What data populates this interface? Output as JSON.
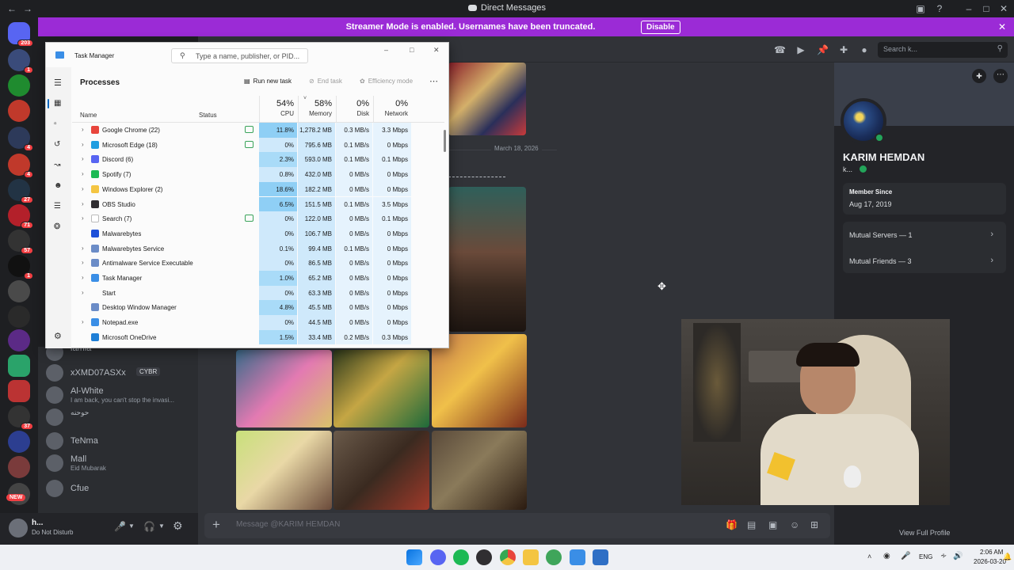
{
  "window": {
    "title": "Direct Messages"
  },
  "streamer_banner": {
    "message": "Streamer Mode is enabled. Usernames have been truncated.",
    "disable_label": "Disable"
  },
  "rail": {
    "home_badge": "203",
    "badges": [
      "1",
      "4",
      "4",
      "27",
      "71",
      "57",
      "1",
      "37"
    ],
    "new_label": "NEW"
  },
  "dm_list": [
    {
      "name": "lamia",
      "sub": ""
    },
    {
      "name": "xXMD07ASXx",
      "sub": "",
      "tag": "CYBR"
    },
    {
      "name": "Al-White",
      "sub": "I am back, you can't stop the invasi..."
    },
    {
      "name": "حوحنه",
      "sub": ""
    },
    {
      "name": "TeNma",
      "sub": ""
    },
    {
      "name": "Ma‌ll",
      "sub": "Eid Mubarak"
    },
    {
      "name": "Cfue",
      "sub": ""
    }
  ],
  "user_panel": {
    "name": "h...",
    "status": "Do Not Disturb"
  },
  "chat": {
    "date_divider": "March 18, 2026",
    "composer_placeholder": "Message @KARIM HEMDAN"
  },
  "header": {
    "search_placeholder": "Search k..."
  },
  "profile": {
    "display_name": "KARIM HEMDAN",
    "username": "k...",
    "member_since_label": "Member Since",
    "member_since_value": "Aug 17, 2019",
    "mutual_servers": "Mutual Servers — 1",
    "mutual_friends": "Mutual Friends — 3",
    "view_full_profile": "View Full Profile"
  },
  "task_manager": {
    "title": "Task Manager",
    "search_placeholder": "Type a name, publisher, or PID...",
    "section": "Processes",
    "run_new_task": "Run new task",
    "end_task": "End task",
    "efficiency_mode": "Efficiency mode",
    "col_name": "Name",
    "col_status": "Status",
    "cpu_total": "54%",
    "cpu_label": "CPU",
    "mem_total": "58%",
    "mem_label": "Memory",
    "disk_total": "0%",
    "disk_label": "Disk",
    "net_total": "0%",
    "net_label": "Network",
    "processes": [
      {
        "name": "Google Chrome (22)",
        "expand": true,
        "eco": true,
        "cpu": "11.8%",
        "mem": "1,278.2 MB",
        "disk": "0.3 MB/s",
        "net": "3.3 Mbps",
        "icon_color": "#e8453c"
      },
      {
        "name": "Microsoft Edge (18)",
        "expand": true,
        "eco": true,
        "cpu": "0%",
        "mem": "795.6 MB",
        "disk": "0.1 MB/s",
        "net": "0 Mbps",
        "icon_color": "#1f9de0"
      },
      {
        "name": "Discord (6)",
        "expand": true,
        "eco": false,
        "cpu": "2.3%",
        "mem": "593.0 MB",
        "disk": "0.1 MB/s",
        "net": "0.1 Mbps",
        "icon_color": "#5865f2"
      },
      {
        "name": "Spotify (7)",
        "expand": true,
        "eco": false,
        "cpu": "0.8%",
        "mem": "432.0 MB",
        "disk": "0 MB/s",
        "net": "0 Mbps",
        "icon_color": "#1db954"
      },
      {
        "name": "Windows Explorer (2)",
        "expand": true,
        "eco": false,
        "cpu": "18.6%",
        "mem": "182.2 MB",
        "disk": "0 MB/s",
        "net": "0 Mbps",
        "icon_color": "#f4c542"
      },
      {
        "name": "OBS Studio",
        "expand": true,
        "eco": false,
        "cpu": "6.5%",
        "mem": "151.5 MB",
        "disk": "0.1 MB/s",
        "net": "3.5 Mbps",
        "icon_color": "#302e31"
      },
      {
        "name": "Search (7)",
        "expand": true,
        "eco": true,
        "cpu": "0%",
        "mem": "122.0 MB",
        "disk": "0 MB/s",
        "net": "0.1 Mbps",
        "icon_color": "#ffffff"
      },
      {
        "name": "Malwarebytes",
        "expand": false,
        "eco": false,
        "cpu": "0%",
        "mem": "106.7 MB",
        "disk": "0 MB/s",
        "net": "0 Mbps",
        "icon_color": "#1d4fd8"
      },
      {
        "name": "Malwarebytes Service",
        "expand": true,
        "eco": false,
        "cpu": "0.1%",
        "mem": "99.4 MB",
        "disk": "0.1 MB/s",
        "net": "0 Mbps",
        "icon_color": "#6b8cc7"
      },
      {
        "name": "Antimalware Service Executable",
        "expand": true,
        "eco": false,
        "cpu": "0%",
        "mem": "86.5 MB",
        "disk": "0 MB/s",
        "net": "0 Mbps",
        "icon_color": "#6b8cc7"
      },
      {
        "name": "Task Manager",
        "expand": true,
        "eco": false,
        "cpu": "1.0%",
        "mem": "65.2 MB",
        "disk": "0 MB/s",
        "net": "0 Mbps",
        "icon_color": "#3a8ee6"
      },
      {
        "name": "Start",
        "expand": true,
        "eco": false,
        "cpu": "0%",
        "mem": "63.3 MB",
        "disk": "0 MB/s",
        "net": "0 Mbps",
        "icon_color": "transparent"
      },
      {
        "name": "Desktop Window Manager",
        "expand": false,
        "eco": false,
        "cpu": "4.8%",
        "mem": "45.5 MB",
        "disk": "0 MB/s",
        "net": "0 Mbps",
        "icon_color": "#6b8cc7"
      },
      {
        "name": "Notepad.exe",
        "expand": true,
        "eco": false,
        "cpu": "0%",
        "mem": "44.5 MB",
        "disk": "0 MB/s",
        "net": "0 Mbps",
        "icon_color": "#3a8ee6"
      },
      {
        "name": "Microsoft OneDrive",
        "expand": false,
        "eco": false,
        "cpu": "1.5%",
        "mem": "33.4 MB",
        "disk": "0.2 MB/s",
        "net": "0.3 Mbps",
        "icon_color": "#1f7fd6"
      }
    ]
  },
  "taskbar": {
    "lang": "ENG",
    "time": "2:06 AM",
    "date": "2026-03-20"
  }
}
